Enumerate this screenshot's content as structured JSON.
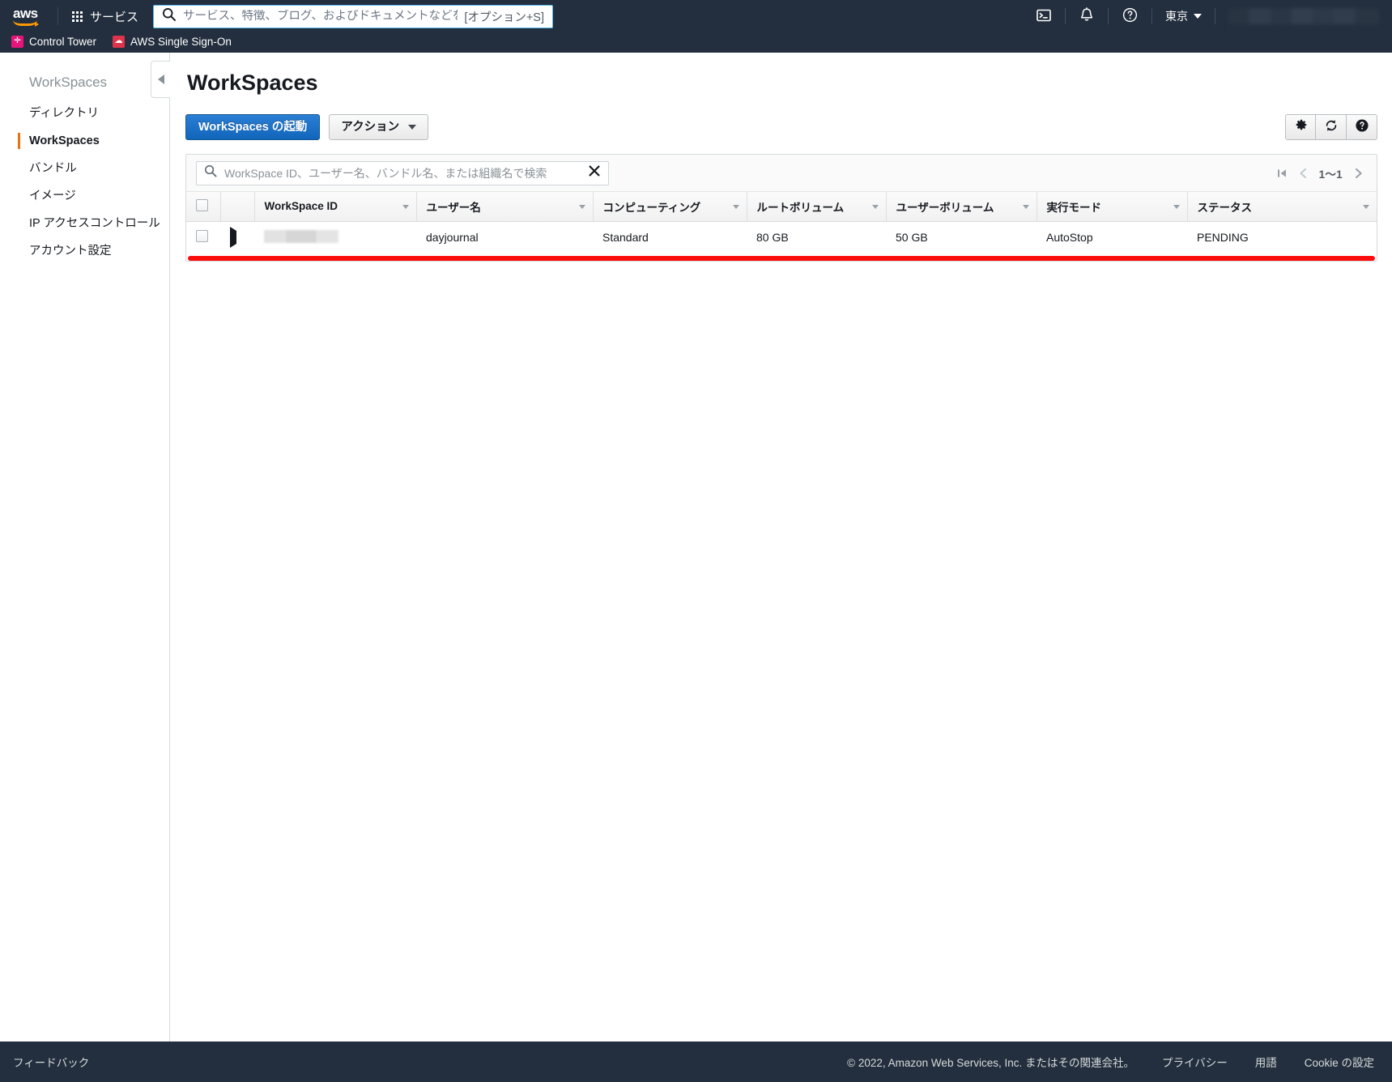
{
  "topnav": {
    "logo_alt": "aws",
    "services_label": "サービス",
    "search": {
      "value": "",
      "placeholder": "サービス、特徴、ブログ、およびドキュメントなどを検索",
      "shortcut": "[オプション+S]"
    },
    "cloudshell_icon": "cloudshell-icon",
    "notifications_icon": "bell-icon",
    "help_icon": "question-circle-icon",
    "region": "東京",
    "account_redacted": true
  },
  "favorites": [
    {
      "label": "Control Tower",
      "color": "#e7157b"
    },
    {
      "label": "AWS Single Sign-On",
      "color": "#dd344c"
    }
  ],
  "sidebar": {
    "title": "WorkSpaces",
    "collapse_icon": "chevron-left-icon",
    "items": [
      {
        "label": "ディレクトリ",
        "active": false
      },
      {
        "label": "WorkSpaces",
        "active": true
      },
      {
        "label": "バンドル",
        "active": false
      },
      {
        "label": "イメージ",
        "active": false
      },
      {
        "label": "IP アクセスコントロール",
        "active": false
      },
      {
        "label": "アカウント設定",
        "active": false
      }
    ]
  },
  "main": {
    "page_title": "WorkSpaces",
    "toolbar": {
      "launch_label": "WorkSpaces の起動",
      "actions_label": "アクション",
      "settings_icon": "gear-icon",
      "refresh_icon": "refresh-icon",
      "help_icon": "question-circle-icon"
    },
    "table_search": {
      "value": "",
      "placeholder": "WorkSpace ID、ユーザー名、バンドル名、または組織名で検索",
      "clear_icon": "close-x-icon"
    },
    "pagination": {
      "first_icon": "first-page-icon",
      "prev_icon": "prev-page-icon",
      "range_label": "1〜1",
      "next_icon": "next-page-icon"
    },
    "table": {
      "columns": [
        "WorkSpace ID",
        "ユーザー名",
        "コンピューティング",
        "ルートボリューム",
        "ユーザーボリューム",
        "実行モード",
        "ステータス"
      ],
      "rows": [
        {
          "workspace_id": "",
          "workspace_id_redacted": true,
          "user_name": "dayjournal",
          "compute": "Standard",
          "root_volume": "80 GB",
          "user_volume": "50 GB",
          "running_mode": "AutoStop",
          "status": "PENDING",
          "status_color": "#e07b24"
        }
      ]
    },
    "annotation": {
      "type": "red-underline",
      "color": "#fc0d0d"
    }
  },
  "footer": {
    "feedback": "フィードバック",
    "copyright": "© 2022, Amazon Web Services, Inc. またはその関連会社。",
    "links": [
      "プライバシー",
      "用語",
      "Cookie の設定"
    ]
  }
}
